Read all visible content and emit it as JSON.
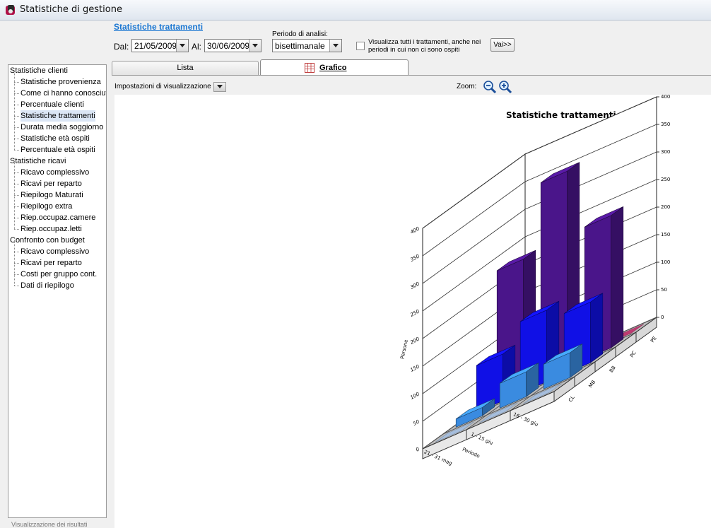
{
  "window": {
    "title": "Statistiche di gestione",
    "icon": "app-logo-icon"
  },
  "header": {
    "report_title": "Statistiche trattamenti",
    "dal_label": "Dal:",
    "dal_value": "21/05/2009",
    "al_label": "Al:",
    "al_value": "30/06/2009",
    "periodo_label": "Periodo di analisi:",
    "periodo_value": "bisettimanale",
    "checkbox_label": "Visualizza tutti i trattamenti, anche nei periodi in cui non ci sono ospiti",
    "checkbox_checked": false,
    "vai_label": "Vai>>"
  },
  "sidebar": {
    "items": [
      {
        "label": "Statistiche clienti",
        "level": 0
      },
      {
        "label": "Statistiche provenienza",
        "level": 1
      },
      {
        "label": "Come ci hanno conosciuto",
        "level": 1
      },
      {
        "label": "Percentuale clienti",
        "level": 1
      },
      {
        "label": "Statistiche trattamenti",
        "level": 1,
        "selected": true
      },
      {
        "label": "Durata media soggiorno",
        "level": 1
      },
      {
        "label": "Statistiche età ospiti",
        "level": 1
      },
      {
        "label": "Percentuale età ospiti",
        "level": 1
      },
      {
        "label": "Statistiche ricavi",
        "level": 0
      },
      {
        "label": "Ricavo complessivo",
        "level": 1
      },
      {
        "label": "Ricavi per reparto",
        "level": 1
      },
      {
        "label": "Riepilogo Maturati",
        "level": 1
      },
      {
        "label": "Riepilogo extra",
        "level": 1
      },
      {
        "label": "Riep.occupaz.camere",
        "level": 1
      },
      {
        "label": "Riep.occupaz.letti",
        "level": 1
      },
      {
        "label": "Confronto con budget",
        "level": 0
      },
      {
        "label": "Ricavo complessivo",
        "level": 1
      },
      {
        "label": "Ricavi per reparto",
        "level": 1
      },
      {
        "label": "Costi per gruppo cont.",
        "level": 1
      },
      {
        "label": "Dati di riepilogo",
        "level": 1
      }
    ],
    "footer": "Visualizzazione dei risultati"
  },
  "tabs": [
    {
      "label": "Lista",
      "active": false
    },
    {
      "label": "Grafico",
      "active": true,
      "icon": "chart-icon"
    }
  ],
  "toolbar": {
    "settings_label": "Impostazioni di visualizzazione",
    "zoom_label": "Zoom:"
  },
  "chart_data": {
    "type": "bar",
    "style": "3d",
    "title": "Statistiche trattamenti",
    "xlabel": "Periodo",
    "ylabel": "Persone",
    "categories": [
      "21 - 31 mag",
      "1 - 15 giu",
      "16 - 30 giu"
    ],
    "series": [
      {
        "name": "CL",
        "values": [
          0,
          0,
          0
        ],
        "color": "#9fbfe8"
      },
      {
        "name": "MB",
        "values": [
          15,
          45,
          45
        ],
        "color": "#3a8be0"
      },
      {
        "name": "BB",
        "values": [
          85,
          130,
          110
        ],
        "color": "#1010e6"
      },
      {
        "name": "PC",
        "values": [
          230,
          355,
          240
        ],
        "color": "#4a158a"
      },
      {
        "name": "PE",
        "values": [
          0,
          0,
          0
        ],
        "color": "#c0105a"
      }
    ],
    "left_ticks": [
      0,
      50,
      100,
      150,
      200,
      250,
      300,
      350,
      400
    ],
    "right_ticks": [
      0,
      50,
      100,
      150,
      200,
      250,
      300,
      350,
      400
    ],
    "ylim": [
      0,
      400
    ],
    "grid": true
  }
}
